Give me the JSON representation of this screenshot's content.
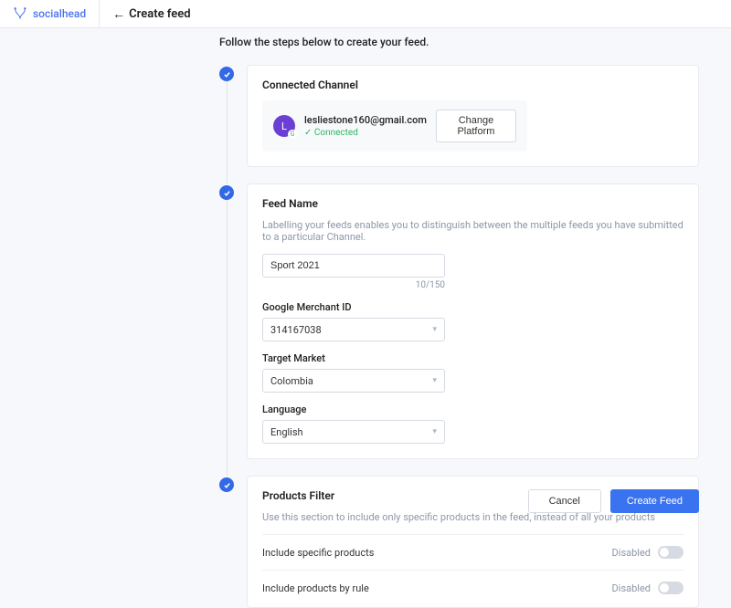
{
  "brand": "socialhead",
  "page_title": "Create feed",
  "instructions": "Follow the steps below to create your feed.",
  "steps": {
    "connected_channel": {
      "title": "Connected Channel",
      "email": "lesliestone160@gmail.com",
      "status": "Connected",
      "avatar_initial": "L",
      "change_platform_label": "Change Platform"
    },
    "feed_name": {
      "title": "Feed Name",
      "desc": "Labelling your feeds enables you to distinguish between the multiple feeds you have submitted to a particular Channel.",
      "name_value": "Sport 2021",
      "name_counter": "10/150",
      "merchant_label": "Google Merchant ID",
      "merchant_value": "314167038",
      "market_label": "Target Market",
      "market_value": "Colombia",
      "language_label": "Language",
      "language_value": "English"
    },
    "products_filter": {
      "title": "Products Filter",
      "desc": "Use this section to include only specific products in the feed, instead of all your products",
      "rows": [
        {
          "label": "Include specific products",
          "state": "Disabled"
        },
        {
          "label": "Include products by rule",
          "state": "Disabled"
        }
      ]
    }
  },
  "footer": {
    "cancel": "Cancel",
    "create": "Create Feed"
  }
}
